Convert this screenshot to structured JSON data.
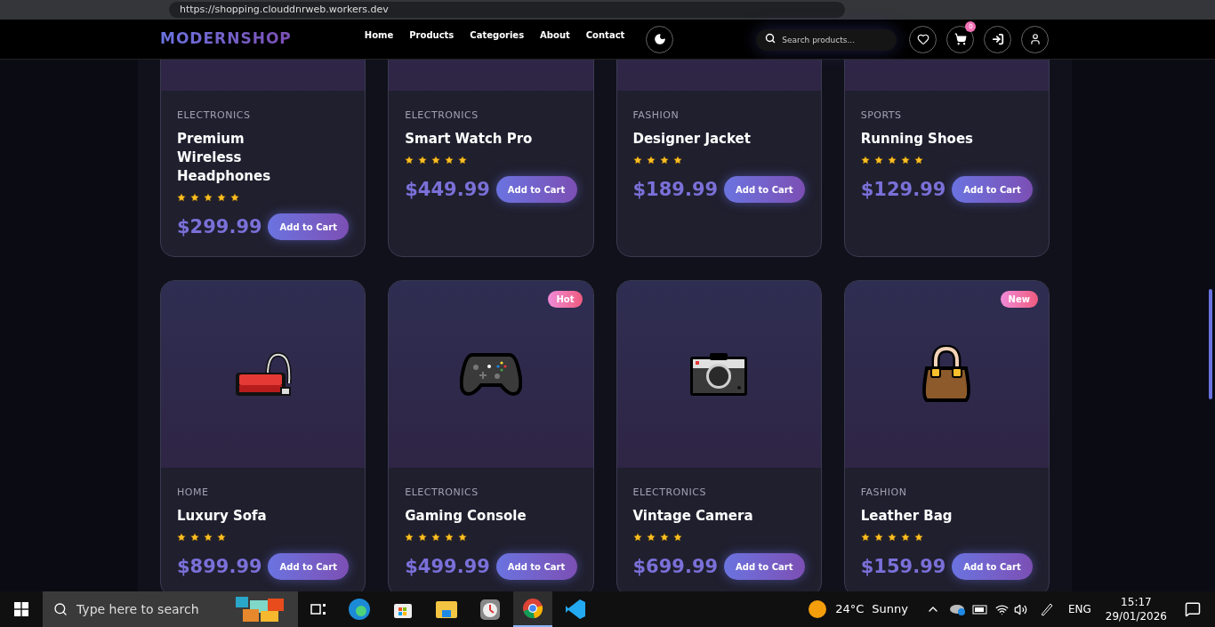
{
  "browser": {
    "url": "https://shopping.clouddnrweb.workers.dev"
  },
  "header": {
    "logo": "MODERNSHOP",
    "nav": [
      "Home",
      "Products",
      "Categories",
      "About",
      "Contact"
    ],
    "search": {
      "placeholder": "Search products..."
    },
    "cart_count": "0"
  },
  "products": [
    {
      "category": "ELECTRONICS",
      "name": "Premium Wireless Headphones",
      "stars": 5,
      "price": "$299.99",
      "button": "Add to Cart"
    },
    {
      "category": "ELECTRONICS",
      "name": "Smart Watch Pro",
      "stars": 5,
      "price": "$449.99",
      "button": "Add to Cart"
    },
    {
      "category": "FASHION",
      "name": "Designer Jacket",
      "stars": 4,
      "price": "$189.99",
      "button": "Add to Cart"
    },
    {
      "category": "SPORTS",
      "name": "Running Shoes",
      "stars": 5,
      "price": "$129.99",
      "button": "Add to Cart"
    },
    {
      "category": "HOME",
      "name": "Luxury Sofa",
      "stars": 4,
      "price": "$899.99",
      "button": "Add to Cart",
      "kind": "sofa"
    },
    {
      "category": "ELECTRONICS",
      "name": "Gaming Console",
      "stars": 5,
      "price": "$499.99",
      "button": "Add to Cart",
      "kind": "controller",
      "badge": "Hot"
    },
    {
      "category": "ELECTRONICS",
      "name": "Vintage Camera",
      "stars": 4,
      "price": "$699.99",
      "button": "Add to Cart",
      "kind": "camera"
    },
    {
      "category": "FASHION",
      "name": "Leather Bag",
      "stars": 5,
      "price": "$159.99",
      "button": "Add to Cart",
      "kind": "bag",
      "badge": "New"
    }
  ],
  "taskbar": {
    "search_placeholder": "Type here to search",
    "temperature": "24°C",
    "weather": "Sunny",
    "language": "ENG",
    "time": "15:17",
    "date": "29/01/2026"
  }
}
